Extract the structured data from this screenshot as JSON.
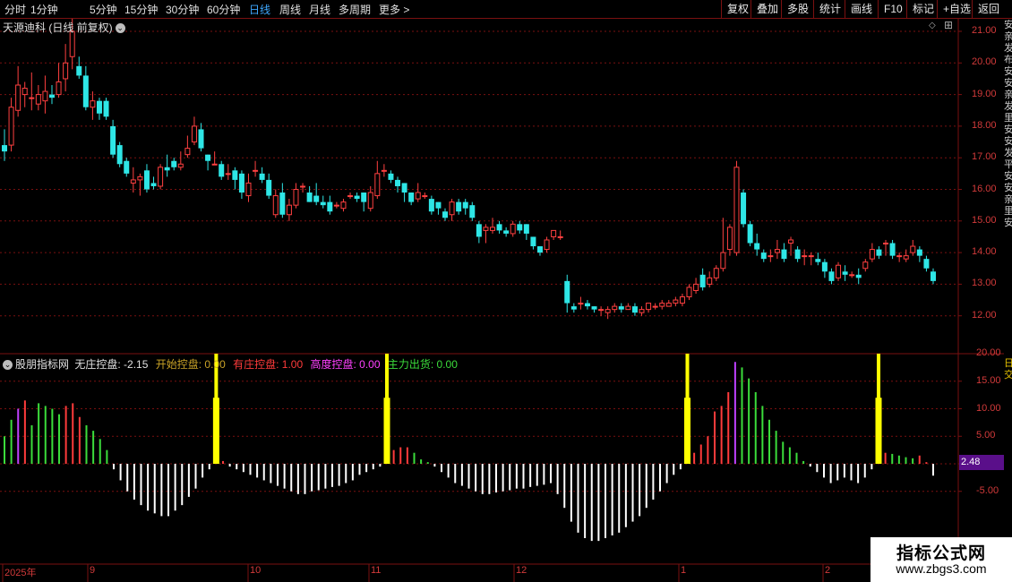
{
  "toolbar": {
    "periods": [
      "分时",
      "1分钟",
      "5分钟",
      "15分钟",
      "30分钟",
      "60分钟",
      "日线",
      "周线",
      "月线",
      "多周期",
      "更多 >"
    ],
    "active_period": "日线",
    "actions": [
      "复权",
      "叠加",
      "多股",
      "统计",
      "画线",
      "F10",
      "标记",
      "+自选",
      "返回"
    ]
  },
  "main_panel": {
    "title": "天源迪科 (日线 前复权)",
    "title_arrow": "⌄",
    "price_axis": [
      "21.00",
      "20.00",
      "19.00",
      "18.00",
      "17.00",
      "16.00",
      "15.00",
      "14.00",
      "13.00",
      "12.00"
    ]
  },
  "indicator_panel": {
    "name": "股朋指标网",
    "items": [
      {
        "label": "无庄控盘: -2.15",
        "color": "#e0e0e0"
      },
      {
        "label": "开始控盘: 0.00",
        "color": "#c9a227"
      },
      {
        "label": "有庄控盘: 1.00",
        "color": "#ff3b3b"
      },
      {
        "label": "高度控盘: 0.00",
        "color": "#ff40ff"
      },
      {
        "label": "主力出货: 0.00",
        "color": "#3bdc3b"
      }
    ],
    "axis": [
      "20.00",
      "15.00",
      "10.00",
      "5.00",
      "0.00",
      "-5.00"
    ],
    "current_value": "2.48"
  },
  "time_axis": [
    "2025年",
    "9",
    "10",
    "11",
    "12",
    "1",
    "2"
  ],
  "right_strip": {
    "top_text": "安亲发布安安亲发里安安发平安安亲里安",
    "bottom_text": "日交"
  },
  "watermark": {
    "title": "指标公式网",
    "url": "www.zbgs3.com"
  },
  "colors": {
    "up": "#ff4040",
    "down": "#2ee6e6",
    "grid": "#7a1010",
    "signal": "#ffff00"
  },
  "chart_data": {
    "type": "candlestick+bar",
    "candles": [
      [
        17.4,
        17.2,
        17.9,
        16.9
      ],
      [
        17.4,
        18.6,
        18.9,
        17.2
      ],
      [
        18.5,
        19.3,
        19.9,
        18.3
      ],
      [
        19.0,
        19.2,
        19.4,
        18.6
      ],
      [
        18.9,
        18.9,
        19.7,
        18.5
      ],
      [
        18.7,
        19.0,
        19.3,
        18.5
      ],
      [
        18.8,
        19.1,
        19.6,
        18.4
      ],
      [
        19.0,
        18.9,
        19.3,
        18.7
      ],
      [
        19.0,
        19.4,
        20.0,
        18.9
      ],
      [
        19.5,
        20.0,
        20.6,
        19.1
      ],
      [
        20.2,
        21.0,
        21.4,
        19.8
      ],
      [
        19.9,
        19.6,
        20.2,
        19.5
      ],
      [
        19.6,
        18.6,
        19.9,
        18.5
      ],
      [
        18.6,
        18.8,
        19.1,
        18.2
      ],
      [
        18.8,
        18.4,
        18.9,
        18.2
      ],
      [
        18.8,
        18.3,
        18.9,
        18.2
      ],
      [
        18.0,
        17.1,
        18.2,
        17.0
      ],
      [
        17.4,
        16.8,
        17.5,
        16.7
      ],
      [
        16.9,
        16.5,
        17.0,
        16.4
      ],
      [
        16.2,
        16.3,
        16.7,
        15.9
      ],
      [
        16.3,
        16.4,
        16.5,
        15.8
      ],
      [
        16.6,
        16.0,
        16.8,
        15.9
      ],
      [
        16.2,
        16.1,
        16.4,
        16.0
      ],
      [
        16.1,
        16.7,
        16.8,
        16.0
      ],
      [
        16.7,
        16.6,
        17.1,
        16.4
      ],
      [
        16.9,
        16.7,
        17.0,
        16.6
      ],
      [
        16.7,
        16.8,
        17.2,
        16.6
      ],
      [
        17.1,
        17.3,
        17.7,
        17.0
      ],
      [
        17.5,
        18.0,
        18.3,
        17.4
      ],
      [
        17.9,
        17.3,
        18.1,
        17.2
      ],
      [
        17.1,
        16.9,
        17.1,
        16.6
      ],
      [
        16.8,
        16.8,
        17.2,
        16.8
      ],
      [
        16.8,
        16.4,
        16.9,
        16.3
      ],
      [
        16.5,
        16.5,
        16.8,
        16.3
      ],
      [
        16.6,
        16.3,
        16.7,
        16.0
      ],
      [
        16.5,
        15.9,
        16.6,
        15.7
      ],
      [
        15.8,
        16.2,
        16.5,
        15.6
      ],
      [
        16.6,
        16.6,
        16.9,
        16.4
      ],
      [
        16.5,
        16.3,
        16.7,
        16.2
      ],
      [
        16.3,
        15.8,
        16.5,
        15.7
      ],
      [
        15.2,
        15.8,
        16.0,
        15.1
      ],
      [
        15.9,
        15.2,
        16.2,
        15.1
      ],
      [
        15.2,
        15.5,
        15.7,
        15.0
      ],
      [
        15.5,
        16.0,
        16.2,
        15.4
      ],
      [
        16.1,
        16.1,
        16.2,
        15.9
      ],
      [
        15.9,
        15.6,
        16.1,
        15.6
      ],
      [
        15.8,
        15.6,
        16.2,
        15.5
      ],
      [
        15.6,
        15.5,
        15.8,
        15.4
      ],
      [
        15.6,
        15.3,
        15.8,
        15.2
      ],
      [
        15.5,
        15.5,
        15.6,
        15.4
      ],
      [
        15.4,
        15.6,
        15.7,
        15.3
      ],
      [
        15.8,
        15.8,
        15.9,
        15.7
      ],
      [
        15.8,
        15.7,
        15.9,
        15.6
      ],
      [
        15.9,
        15.6,
        15.9,
        15.3
      ],
      [
        15.4,
        15.9,
        16.1,
        15.3
      ],
      [
        15.8,
        16.5,
        16.9,
        15.7
      ],
      [
        16.6,
        16.6,
        16.8,
        16.4
      ],
      [
        16.5,
        16.3,
        16.6,
        16.2
      ],
      [
        16.3,
        16.1,
        16.4,
        15.9
      ],
      [
        16.2,
        15.9,
        16.2,
        15.6
      ],
      [
        15.9,
        15.6,
        15.9,
        15.5
      ],
      [
        15.7,
        15.9,
        16.2,
        15.6
      ],
      [
        15.8,
        15.8,
        15.9,
        15.7
      ],
      [
        15.7,
        15.3,
        15.8,
        15.2
      ],
      [
        15.6,
        15.4,
        15.6,
        15.2
      ],
      [
        15.3,
        15.1,
        15.4,
        15.0
      ],
      [
        15.2,
        15.6,
        15.7,
        15.0
      ],
      [
        15.6,
        15.3,
        15.7,
        15.2
      ],
      [
        15.6,
        15.4,
        15.7,
        15.2
      ],
      [
        15.5,
        15.1,
        15.6,
        15.0
      ],
      [
        14.9,
        14.5,
        15.0,
        14.3
      ],
      [
        14.7,
        14.8,
        14.9,
        14.3
      ],
      [
        14.7,
        14.8,
        15.1,
        14.6
      ],
      [
        14.9,
        14.7,
        15.0,
        14.6
      ],
      [
        14.7,
        14.6,
        14.8,
        14.5
      ],
      [
        14.6,
        14.9,
        15.0,
        14.5
      ],
      [
        14.9,
        14.7,
        15.0,
        14.6
      ],
      [
        14.9,
        14.6,
        14.9,
        14.4
      ],
      [
        14.5,
        14.2,
        14.5,
        14.1
      ],
      [
        14.2,
        14.0,
        14.2,
        13.9
      ],
      [
        14.1,
        14.4,
        14.5,
        14.0
      ],
      [
        14.5,
        14.7,
        14.7,
        14.4
      ],
      [
        14.5,
        14.5,
        14.7,
        14.4
      ],
      [
        13.1,
        12.4,
        13.3,
        12.1
      ],
      [
        12.3,
        12.2,
        12.4,
        12.1
      ],
      [
        12.4,
        12.4,
        12.6,
        12.2
      ],
      [
        12.4,
        12.3,
        12.5,
        12.2
      ],
      [
        12.3,
        12.2,
        12.3,
        12.1
      ],
      [
        12.2,
        12.2,
        12.3,
        12.0
      ],
      [
        12.1,
        12.2,
        12.3,
        11.9
      ],
      [
        12.2,
        12.3,
        12.4,
        12.1
      ],
      [
        12.3,
        12.2,
        12.4,
        12.1
      ],
      [
        12.2,
        12.3,
        12.4,
        12.2
      ],
      [
        12.3,
        12.1,
        12.4,
        12.0
      ],
      [
        12.1,
        12.2,
        12.3,
        12.0
      ],
      [
        12.2,
        12.4,
        12.4,
        12.1
      ],
      [
        12.3,
        12.3,
        12.4,
        12.2
      ],
      [
        12.3,
        12.4,
        12.5,
        12.2
      ],
      [
        12.3,
        12.4,
        12.5,
        12.3
      ],
      [
        12.4,
        12.5,
        12.6,
        12.3
      ],
      [
        12.4,
        12.6,
        12.7,
        12.3
      ],
      [
        12.6,
        12.9,
        13.0,
        12.5
      ],
      [
        12.8,
        13.0,
        13.2,
        12.7
      ],
      [
        13.3,
        12.9,
        13.5,
        12.8
      ],
      [
        13.0,
        13.2,
        13.4,
        12.9
      ],
      [
        13.2,
        13.5,
        13.6,
        13.1
      ],
      [
        13.5,
        14.0,
        15.1,
        13.4
      ],
      [
        14.1,
        14.8,
        14.9,
        13.9
      ],
      [
        14.0,
        16.7,
        16.9,
        13.9
      ],
      [
        15.9,
        14.9,
        16.0,
        14.8
      ],
      [
        14.9,
        14.3,
        15.0,
        14.2
      ],
      [
        14.3,
        14.1,
        14.6,
        13.9
      ],
      [
        14.0,
        13.8,
        14.1,
        13.7
      ],
      [
        13.9,
        13.9,
        14.1,
        13.7
      ],
      [
        14.0,
        14.1,
        14.4,
        13.8
      ],
      [
        14.1,
        13.8,
        14.3,
        13.7
      ],
      [
        14.3,
        14.4,
        14.5,
        13.9
      ],
      [
        14.1,
        13.8,
        14.2,
        13.7
      ],
      [
        13.9,
        13.9,
        14.1,
        13.6
      ],
      [
        13.9,
        13.9,
        14.0,
        13.6
      ],
      [
        13.8,
        13.7,
        14.0,
        13.6
      ],
      [
        13.7,
        13.4,
        13.8,
        13.2
      ],
      [
        13.4,
        13.1,
        13.5,
        13.0
      ],
      [
        13.2,
        13.6,
        13.7,
        13.1
      ],
      [
        13.4,
        13.3,
        13.6,
        13.1
      ],
      [
        13.3,
        13.3,
        13.4,
        13.2
      ],
      [
        13.3,
        13.2,
        13.5,
        13.0
      ],
      [
        13.5,
        13.7,
        13.8,
        13.4
      ],
      [
        13.8,
        14.1,
        14.3,
        13.7
      ],
      [
        14.1,
        13.9,
        14.2,
        13.8
      ],
      [
        14.3,
        14.3,
        14.4,
        13.9
      ],
      [
        14.3,
        13.9,
        14.4,
        13.8
      ],
      [
        13.9,
        13.9,
        14.0,
        13.7
      ],
      [
        13.8,
        13.9,
        14.1,
        13.7
      ],
      [
        14.0,
        14.2,
        14.4,
        13.9
      ],
      [
        14.1,
        13.9,
        14.2,
        13.7
      ],
      [
        13.8,
        13.5,
        13.9,
        13.4
      ],
      [
        13.4,
        13.1,
        13.5,
        13.0
      ]
    ],
    "indicator_bars": [
      [
        5,
        "g"
      ],
      [
        8,
        "g"
      ],
      [
        10,
        "m"
      ],
      [
        11.5,
        "r"
      ],
      [
        7,
        "g"
      ],
      [
        11,
        "g"
      ],
      [
        10.5,
        "g"
      ],
      [
        10,
        "g"
      ],
      [
        9,
        "g"
      ],
      [
        10.5,
        "r"
      ],
      [
        11,
        "r"
      ],
      [
        8.5,
        "r"
      ],
      [
        7,
        "g"
      ],
      [
        6,
        "g"
      ],
      [
        4.5,
        "g"
      ],
      [
        2.5,
        "g"
      ],
      [
        -1,
        "w"
      ],
      [
        -3,
        "w"
      ],
      [
        -5,
        "w"
      ],
      [
        -6.5,
        "w"
      ],
      [
        -7.5,
        "w"
      ],
      [
        -8.5,
        "w"
      ],
      [
        -9,
        "w"
      ],
      [
        -9.5,
        "w"
      ],
      [
        -9.5,
        "w"
      ],
      [
        -8.5,
        "w"
      ],
      [
        -7.5,
        "w"
      ],
      [
        -6,
        "w"
      ],
      [
        -4.5,
        "w"
      ],
      [
        -2.5,
        "w"
      ],
      [
        -1,
        "w"
      ],
      [
        20,
        "y"
      ],
      [
        0.5,
        "r"
      ],
      [
        -0.5,
        "w"
      ],
      [
        -1,
        "w"
      ],
      [
        -1.5,
        "w"
      ],
      [
        -2,
        "w"
      ],
      [
        -2.5,
        "w"
      ],
      [
        -3,
        "w"
      ],
      [
        -3.5,
        "w"
      ],
      [
        -4,
        "w"
      ],
      [
        -4.5,
        "w"
      ],
      [
        -5,
        "w"
      ],
      [
        -5.5,
        "w"
      ],
      [
        -5.5,
        "w"
      ],
      [
        -5,
        "w"
      ],
      [
        -4.8,
        "w"
      ],
      [
        -4.5,
        "w"
      ],
      [
        -4.2,
        "w"
      ],
      [
        -4,
        "w"
      ],
      [
        -3.5,
        "w"
      ],
      [
        -3,
        "w"
      ],
      [
        -2,
        "w"
      ],
      [
        -1.5,
        "w"
      ],
      [
        -1,
        "w"
      ],
      [
        -0.5,
        "w"
      ],
      [
        20,
        "y"
      ],
      [
        2.5,
        "r"
      ],
      [
        3,
        "r"
      ],
      [
        3,
        "r"
      ],
      [
        2,
        "g"
      ],
      [
        0.8,
        "g"
      ],
      [
        0.3,
        "g"
      ],
      [
        -0.5,
        "w"
      ],
      [
        -1.5,
        "w"
      ],
      [
        -2.5,
        "w"
      ],
      [
        -3.5,
        "w"
      ],
      [
        -4,
        "w"
      ],
      [
        -4.5,
        "w"
      ],
      [
        -5,
        "w"
      ],
      [
        -5.5,
        "w"
      ],
      [
        -5.5,
        "w"
      ],
      [
        -5.2,
        "w"
      ],
      [
        -5,
        "w"
      ],
      [
        -4.8,
        "w"
      ],
      [
        -4.5,
        "w"
      ],
      [
        -4.5,
        "w"
      ],
      [
        -4.2,
        "w"
      ],
      [
        -4,
        "w"
      ],
      [
        -3.8,
        "w"
      ],
      [
        -3.5,
        "w"
      ],
      [
        -5.5,
        "w"
      ],
      [
        -8,
        "w"
      ],
      [
        -10.5,
        "w"
      ],
      [
        -12.5,
        "w"
      ],
      [
        -13.5,
        "w"
      ],
      [
        -14,
        "w"
      ],
      [
        -14,
        "w"
      ],
      [
        -13.5,
        "w"
      ],
      [
        -13,
        "w"
      ],
      [
        -12.5,
        "w"
      ],
      [
        -11.5,
        "w"
      ],
      [
        -10.5,
        "w"
      ],
      [
        -9.5,
        "w"
      ],
      [
        -8,
        "w"
      ],
      [
        -6.5,
        "w"
      ],
      [
        -5,
        "w"
      ],
      [
        -3.5,
        "w"
      ],
      [
        -2,
        "w"
      ],
      [
        -1,
        "w"
      ],
      [
        20,
        "y"
      ],
      [
        2,
        "r"
      ],
      [
        3.5,
        "r"
      ],
      [
        5,
        "r"
      ],
      [
        9.5,
        "r"
      ],
      [
        10.5,
        "r"
      ],
      [
        13,
        "r"
      ],
      [
        18.5,
        "m"
      ],
      [
        17.5,
        "g"
      ],
      [
        15.5,
        "g"
      ],
      [
        13,
        "g"
      ],
      [
        10.5,
        "g"
      ],
      [
        8,
        "g"
      ],
      [
        6,
        "g"
      ],
      [
        4,
        "g"
      ],
      [
        3,
        "g"
      ],
      [
        2,
        "g"
      ],
      [
        0.5,
        "g"
      ],
      [
        -0.5,
        "w"
      ],
      [
        -1.5,
        "w"
      ],
      [
        -2.5,
        "w"
      ],
      [
        -3.5,
        "w"
      ],
      [
        -3,
        "w"
      ],
      [
        -2.5,
        "w"
      ],
      [
        -3,
        "w"
      ],
      [
        -3.5,
        "w"
      ],
      [
        -2.5,
        "w"
      ],
      [
        -1,
        "w"
      ],
      [
        20,
        "y"
      ],
      [
        2,
        "r"
      ],
      [
        1.8,
        "g"
      ],
      [
        1.5,
        "g"
      ],
      [
        1.2,
        "g"
      ],
      [
        1,
        "g"
      ],
      [
        1.5,
        "r"
      ],
      [
        0.3,
        "r"
      ],
      [
        -2.15,
        "w"
      ]
    ],
    "price_range": [
      11.7,
      21.7
    ],
    "indicator_range": [
      -14.5,
      21.5
    ],
    "xlabel": "",
    "ylabel": ""
  }
}
